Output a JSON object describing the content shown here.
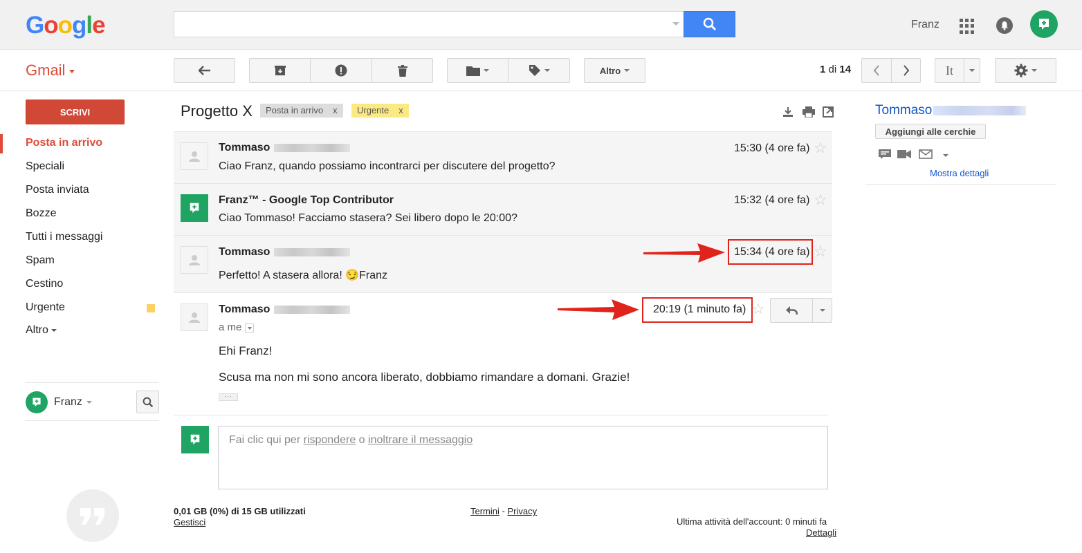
{
  "header": {
    "logo_letters": [
      {
        "ch": "G",
        "color": "#4285f4"
      },
      {
        "ch": "o",
        "color": "#ea4335"
      },
      {
        "ch": "o",
        "color": "#fbbc05"
      },
      {
        "ch": "g",
        "color": "#4285f4"
      },
      {
        "ch": "l",
        "color": "#34a853"
      },
      {
        "ch": "e",
        "color": "#ea4335"
      }
    ],
    "search_value": "",
    "user_name": "Franz",
    "icons": [
      "search-icon",
      "apps-grid-icon",
      "notifications-bell-icon",
      "hangouts-avatar-icon"
    ]
  },
  "toolbar": {
    "app_label": "Gmail",
    "more_label": "Altro",
    "pager": {
      "current": "1",
      "separator": "di",
      "total": "14"
    },
    "input_tool_label": "It",
    "icons": [
      "back-arrow-icon",
      "archive-icon",
      "report-spam-icon",
      "delete-icon",
      "move-to-folder-icon",
      "label-tag-icon",
      "chevron-left-icon",
      "chevron-right-icon",
      "settings-gear-icon"
    ]
  },
  "sidebar": {
    "compose_label": "SCRIVI",
    "items": [
      {
        "label": "Posta in arrivo",
        "active": true
      },
      {
        "label": "Speciali"
      },
      {
        "label": "Posta inviata"
      },
      {
        "label": "Bozze"
      },
      {
        "label": "Tutti i messaggi"
      },
      {
        "label": "Spam"
      },
      {
        "label": "Cestino"
      },
      {
        "label": "Urgente",
        "swatch": "#fad165"
      },
      {
        "label": "Altro"
      }
    ],
    "hangouts_user": "Franz"
  },
  "thread": {
    "subject": "Progetto X",
    "labels": [
      {
        "text": "Posta in arrivo",
        "remove": "x",
        "bg": "#dddddd"
      },
      {
        "text": "Urgente",
        "remove": "x",
        "bg": "#fbe983"
      }
    ],
    "messages": [
      {
        "sender": "Tommaso",
        "snippet": "Ciao Franz, quando possiamo incontrarci per discutere del progetto?",
        "time": "15:30 (4 ore fa)"
      },
      {
        "sender": "Franz™ - Google Top Contributor",
        "snippet": "Ciao Tommaso! Facciamo stasera? Sei libero dopo le 20:00?",
        "time": "15:32 (4 ore fa)"
      },
      {
        "sender": "Tommaso",
        "snippet": "Perfetto! A stasera allora! 😏Franz",
        "time": "15:34 (4 ore fa)"
      },
      {
        "sender": "Tommaso",
        "to": "a me",
        "time": "20:19 (1 minuto fa)",
        "body": [
          "Ehi Franz!",
          "Scusa ma non mi sono ancora liberato, dobbiamo rimandare a domani. Grazie!"
        ]
      }
    ],
    "reply": {
      "prefix": "Fai clic qui per",
      "reply_link": "rispondere",
      "middle": "o",
      "forward_link": "inoltrare il messaggio"
    }
  },
  "footer": {
    "storage": "0,01 GB (0%) di 15 GB utilizzati",
    "manage": "Gestisci",
    "terms": "Termini",
    "dash": "-",
    "privacy": "Privacy",
    "last_activity": "Ultima attività dell'account: 0 minuti fa",
    "details": "Dettagli"
  },
  "contact": {
    "name": "Tommaso",
    "add_button": "Aggiungi alle cerchie",
    "details_link": "Mostra dettagli"
  },
  "colors": {
    "accent_red": "#dd4b39",
    "link_blue": "#1155cc",
    "annotation_red": "#e0241b",
    "hangouts_green": "#1fa463"
  }
}
